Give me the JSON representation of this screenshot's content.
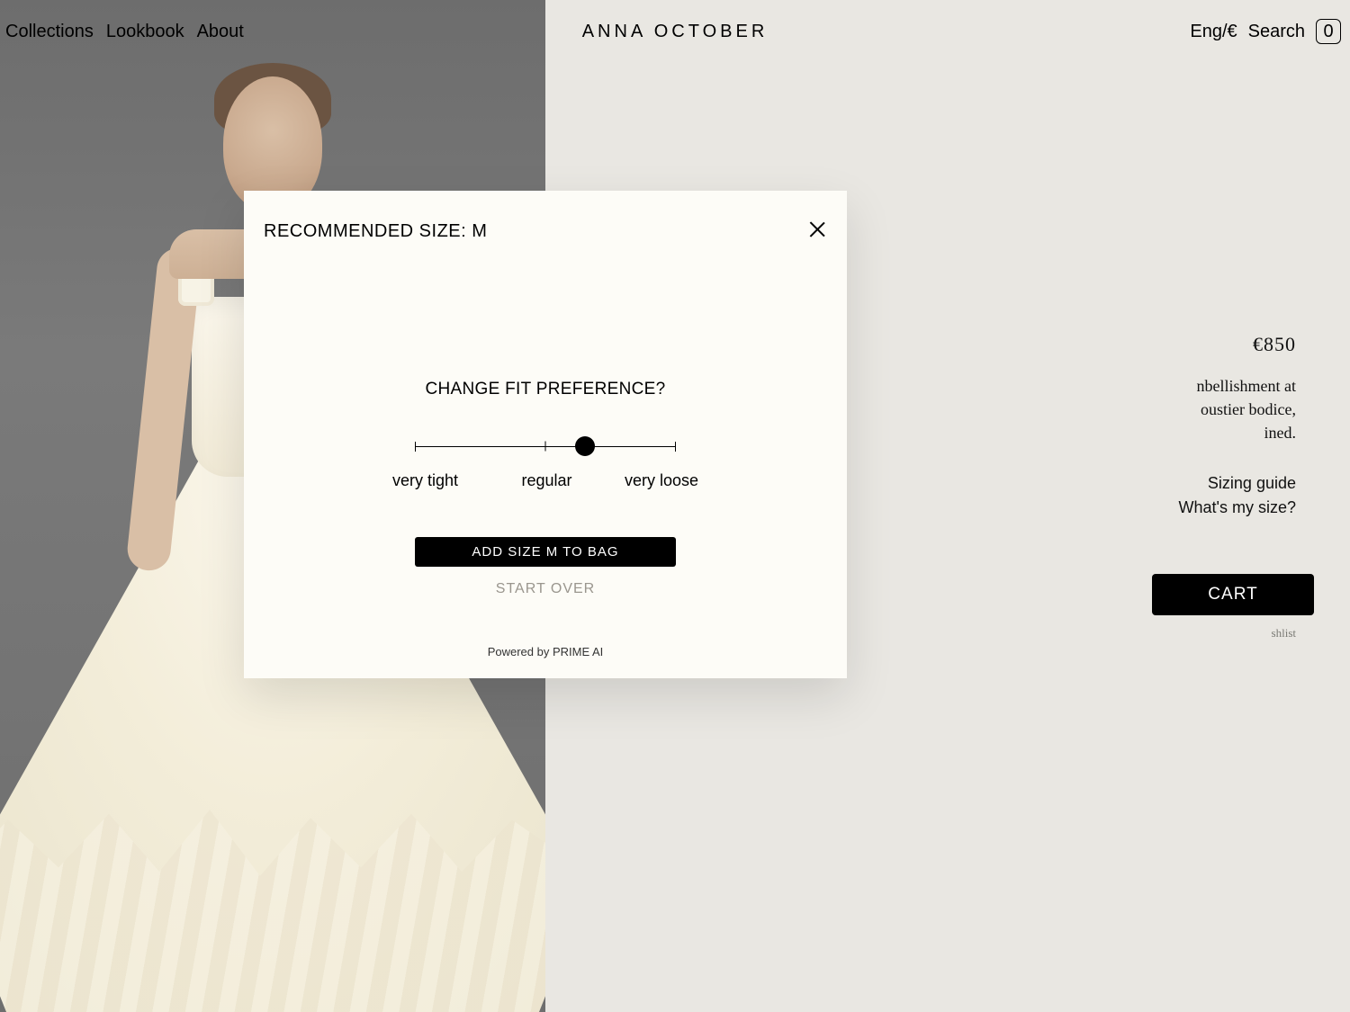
{
  "header": {
    "nav": [
      "Collections",
      "Lookbook",
      "About"
    ],
    "brand": "ANNA OCTOBER",
    "locale": "Eng/€",
    "search": "Search",
    "cart_count": "0"
  },
  "product": {
    "price": "€850",
    "desc_lines": [
      "nbellishment at",
      "oustier bodice,",
      "ined."
    ],
    "sizing_guide": "Sizing guide",
    "whats_my_size": "What's my size?",
    "add_to_cart": "CART",
    "wishlist": "shlist"
  },
  "modal": {
    "title": "RECOMMENDED SIZE: M",
    "question": "CHANGE FIT PREFERENCE?",
    "labels": {
      "tight": "very tight",
      "regular": "regular",
      "loose": "very loose"
    },
    "cta": "ADD SIZE M TO BAG",
    "start_over": "START OVER",
    "powered": "Powered by PRIME AI"
  }
}
